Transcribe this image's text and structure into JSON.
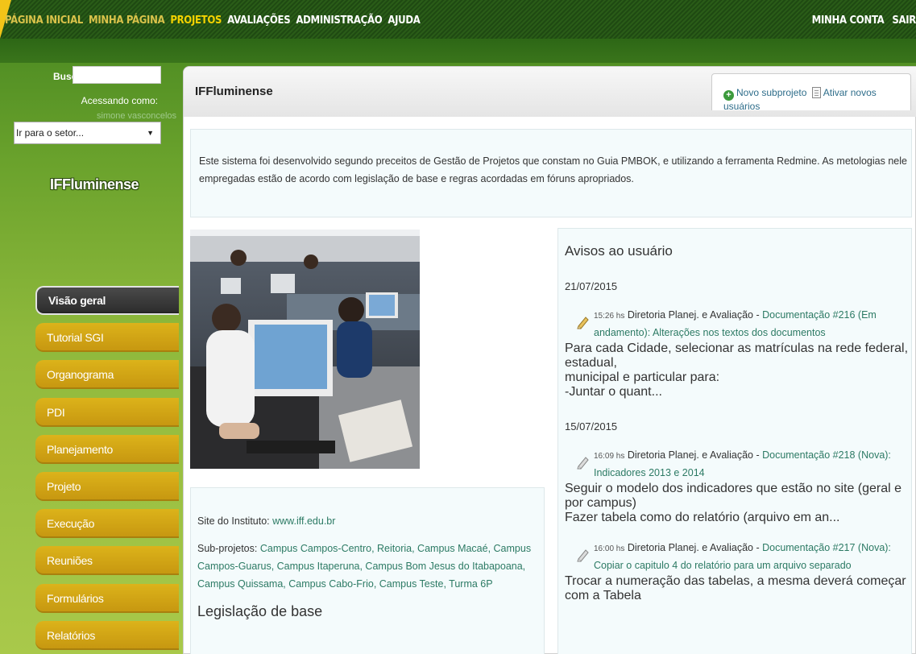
{
  "nav": {
    "left": [
      "PÁGINA INICIAL",
      "MINHA PÁGINA",
      "PROJETOS",
      "AVALIAÇÕES",
      "ADMINISTRAÇÃO",
      "AJUDA"
    ],
    "right": [
      "MINHA CONTA",
      "SAIR"
    ]
  },
  "sidebar": {
    "search_label": "Busca",
    "search_value": "",
    "accessing_label": "Acessando como:",
    "username": "simone vasconcelos",
    "sector_select": "Ir para o setor...",
    "project_name": "IFFluminense",
    "menu": [
      "Visão geral",
      "Tutorial SGI",
      "Organograma",
      "PDI",
      "Planejamento",
      "Projeto",
      "Execução",
      "Reuniões",
      "Formulários",
      "Relatórios"
    ]
  },
  "main": {
    "title": "IFFluminense",
    "actions": {
      "new_subproject": "Novo subprojeto",
      "activate_users": "Ativar novos usuários"
    },
    "intro": "Este sistema foi desenvolvido segundo preceitos de Gestão de Projetos que constam no Guia PMBOK, e utilizando a ferramenta Redmine. As metologias nele empregadas estão de acordo com legislação de base e regras acordadas em fóruns apropriados.",
    "site_label": "Site do Instituto:",
    "site_url": "www.iff.edu.br",
    "subprojects_label": "Sub-projetos:",
    "subprojects": "Campus Campos-Centro, Reitoria, Campus Macaé, Campus Campos-Guarus, Campus Itaperuna, Campus Bom Jesus do Itabapoana, Campus Quissama, Campus Cabo-Frio, Campus Teste, Turma 6P",
    "legislation_title": "Legislação de base"
  },
  "notices": {
    "title": "Avisos ao usuário",
    "groups": [
      {
        "date": "21/07/2015",
        "entries": [
          {
            "time": "15:26 hs",
            "project": "Diretoria Planej. e Avaliação -",
            "link": "Documentação #216 (Em andamento): Alterações nos textos dos documentos",
            "lines": [
              "Para cada Cidade, selecionar as matrículas na rede federal, estadual,",
              "municipal e particular para:",
              "-Juntar o quant..."
            ]
          }
        ]
      },
      {
        "date": "15/07/2015",
        "entries": [
          {
            "time": "16:09 hs",
            "project": "Diretoria Planej. e Avaliação -",
            "link": "Documentação #218 (Nova): Indicadores 2013 e 2014",
            "lines": [
              "Seguir o modelo dos indicadores que estão no site (geral e por campus)",
              "Fazer tabela como do relatório (arquivo em an..."
            ]
          },
          {
            "time": "16:00 hs",
            "project": "Diretoria Planej. e Avaliação -",
            "link": "Documentação #217 (Nova): Copiar o capitulo 4 do relatório para um arquivo separado",
            "lines": [
              "Trocar a numeração das tabelas, a mesma deverá começar com a Tabela"
            ]
          }
        ]
      }
    ]
  }
}
